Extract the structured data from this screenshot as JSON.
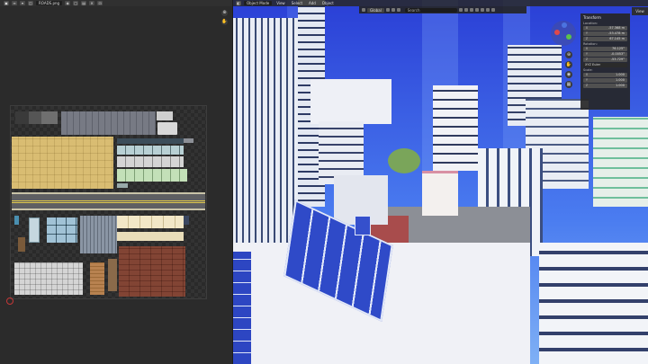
{
  "image_editor": {
    "image_name": "ROADS.png"
  },
  "viewport": {
    "mode": "Object Mode",
    "menus": [
      "View",
      "Select",
      "Add",
      "Object"
    ],
    "orientation": "Global",
    "search_placeholder": "Search",
    "n_panel_tab": "View",
    "transform": {
      "title": "Transform",
      "location_label": "Location:",
      "location": [
        {
          "axis": "X",
          "value": "-57.368 m"
        },
        {
          "axis": "Y",
          "value": "-53.478 m"
        },
        {
          "axis": "Z",
          "value": "67.145 m"
        }
      ],
      "rotation_label": "Rotation:",
      "rotation": [
        {
          "axis": "X",
          "value": "76.125°"
        },
        {
          "axis": "Y",
          "value": "-0.0053°"
        },
        {
          "axis": "Z",
          "value": "-53.729°"
        }
      ],
      "rotation_mode": "XYZ Euler",
      "scale_label": "Scale:",
      "scale": [
        {
          "axis": "X",
          "value": "1.000"
        },
        {
          "axis": "Y",
          "value": "1.000"
        },
        {
          "axis": "Z",
          "value": "1.000"
        }
      ]
    }
  },
  "colors": {
    "sky": "#3056e0",
    "panel_bg": "#2b2b2b",
    "solar_panel": "#2f4ac8"
  }
}
